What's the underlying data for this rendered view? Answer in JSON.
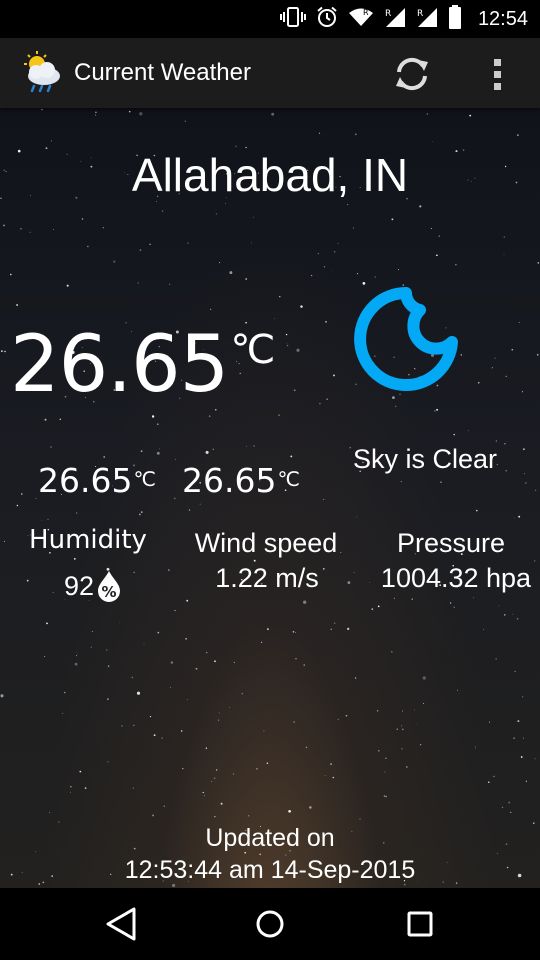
{
  "status_bar": {
    "time": "12:54",
    "icons": [
      "vibrate-icon",
      "alarm-icon",
      "wifi-icon",
      "signal-r-icon",
      "signal-r-icon",
      "battery-icon"
    ]
  },
  "app_bar": {
    "title": "Current Weather",
    "icons": [
      "weather-app-icon",
      "refresh-icon",
      "overflow-menu-icon"
    ]
  },
  "weather": {
    "city": "Allahabad, IN",
    "temperature": "26.65",
    "temperature_unit": "℃",
    "condition_icon": "moon-clear-night-icon",
    "condition": "Sky is Clear",
    "temp_min": "26.65",
    "temp_max": "26.65",
    "small_unit": "℃",
    "humidity_label": "Humidity",
    "humidity_value": "92",
    "humidity_icon": "percent-drop-icon",
    "wind_label": "Wind speed",
    "wind_value": "1.22 m/s",
    "pressure_label": "Pressure",
    "pressure_value": "1004.32 hpa"
  },
  "updated": {
    "line1": "Updated on",
    "line2": "12:53:44 am 14-Sep-2015"
  },
  "nav_bar": {
    "icons": [
      "back-icon",
      "home-icon",
      "recents-icon"
    ]
  },
  "colors": {
    "accent": "#03a9f4",
    "action_bar": "#1c1c1c",
    "text": "#ffffff"
  }
}
